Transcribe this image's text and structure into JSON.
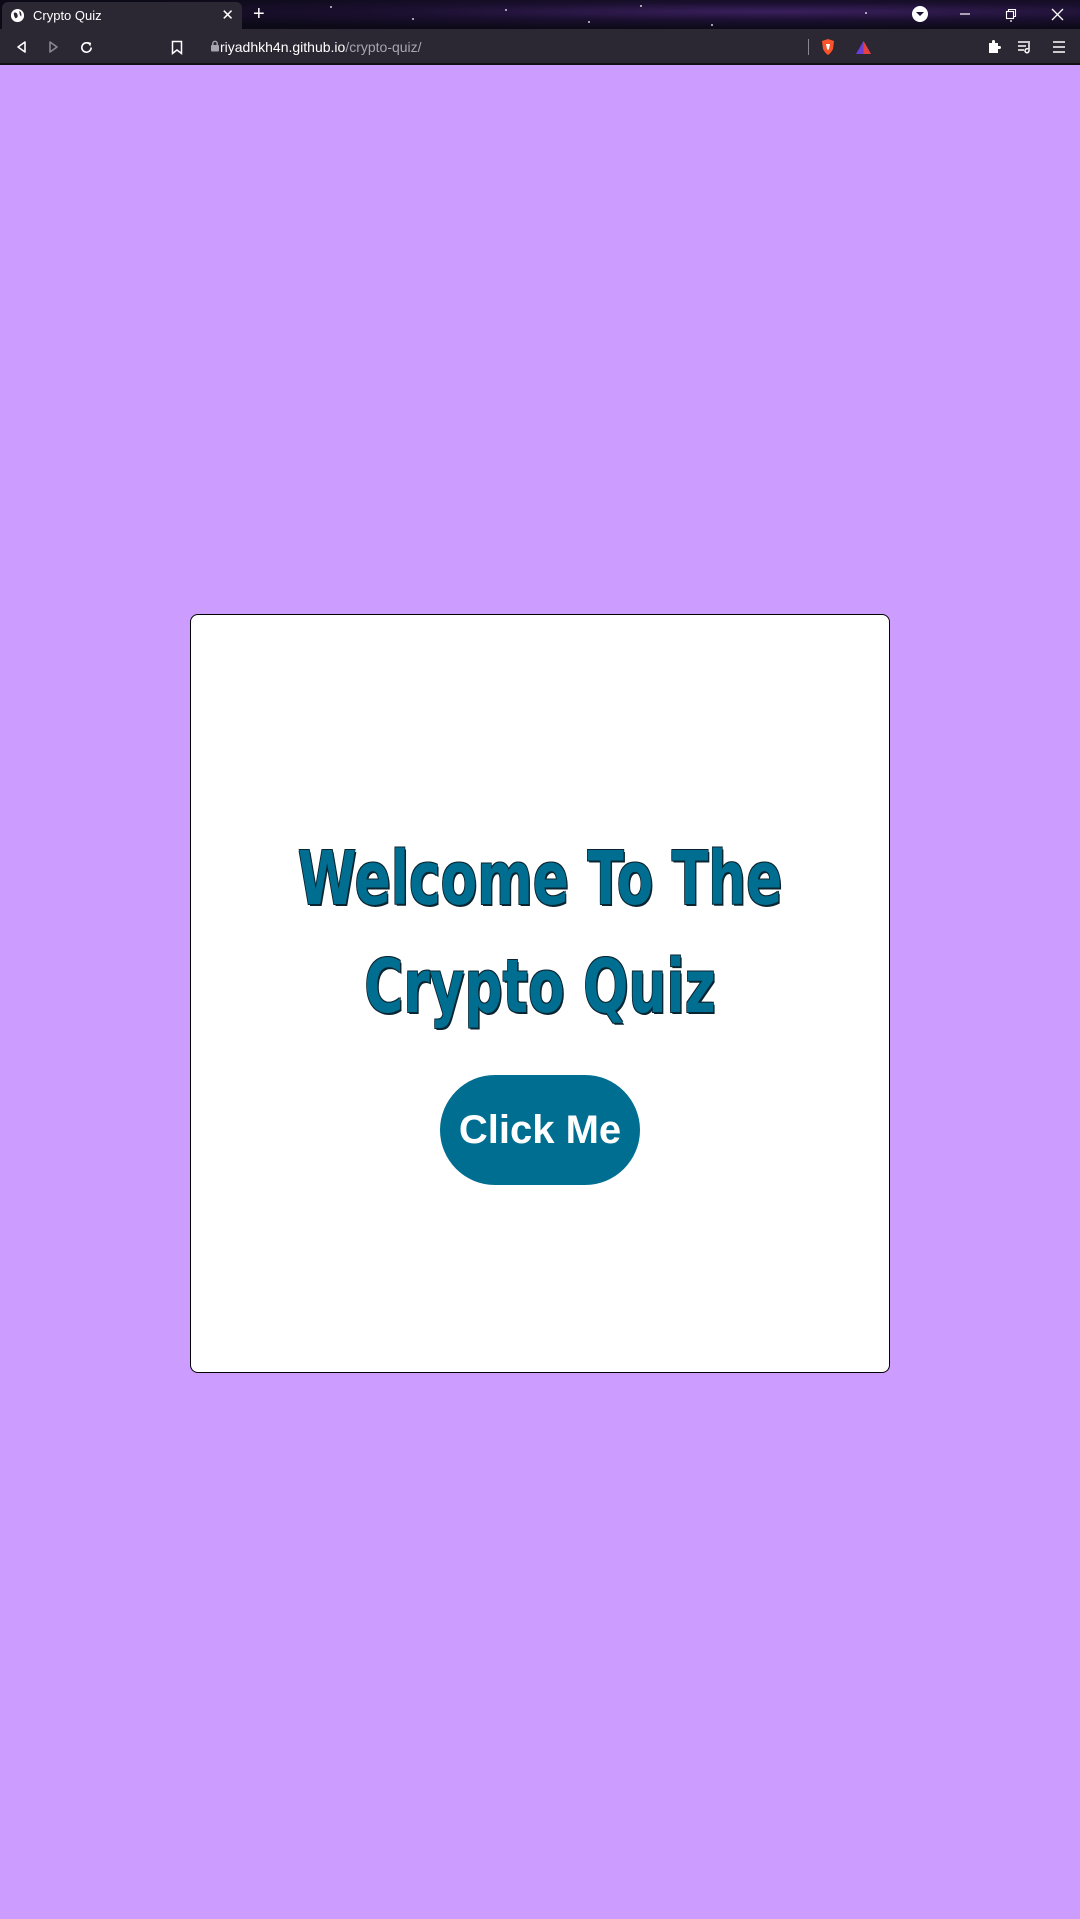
{
  "browser": {
    "tab": {
      "title": "Crypto Quiz",
      "close_glyph": "✕",
      "icon": "globe-icon"
    },
    "new_tab_glyph": "+",
    "address_bar": {
      "host": "riyadhkh4n.github.io",
      "path": "/crypto-quiz/"
    },
    "icons": [
      "back-icon",
      "forward-icon",
      "reload-icon",
      "bookmark-icon",
      "lock-icon",
      "brave-shield-icon",
      "brave-rewards-icon",
      "extensions-icon",
      "reading-list-icon",
      "menu-icon",
      "profile-dropdown-icon",
      "minimize-icon",
      "restore-icon",
      "close-window-icon"
    ]
  },
  "page": {
    "headline": "Welcome To The Crypto Quiz",
    "button_label": "Click Me"
  },
  "colors": {
    "page_background": "#cc9cfe",
    "card_background": "#ffffff",
    "accent": "#006e91",
    "button_text": "#ffffff"
  }
}
